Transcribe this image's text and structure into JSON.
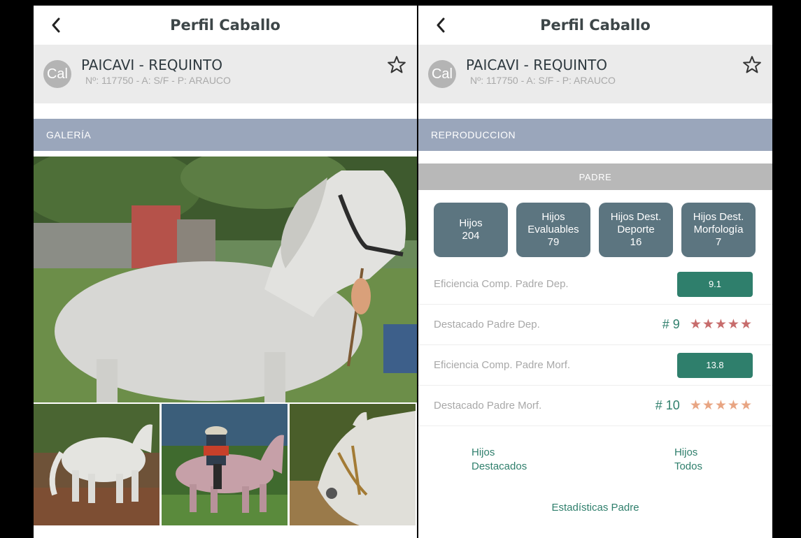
{
  "left": {
    "title": "Perfil Caballo",
    "horse": {
      "avatar_text": "Cal",
      "name": "PAICAVI - REQUINTO",
      "meta": "Nº: 117750 - A: S/F - P: ARAUCO"
    },
    "section": "GALERÍA"
  },
  "right": {
    "title": "Perfil Caballo",
    "horse": {
      "avatar_text": "Cal",
      "name": "PAICAVI - REQUINTO",
      "meta": "Nº: 117750 - A: S/F - P: ARAUCO"
    },
    "section": "REPRODUCCION",
    "subsection": "PADRE",
    "stats": [
      {
        "line1": "Hijos",
        "line2": "",
        "value": "204"
      },
      {
        "line1": "Hijos",
        "line2": "Evaluables",
        "value": "79"
      },
      {
        "line1": "Hijos Dest.",
        "line2": "Deporte",
        "value": "16"
      },
      {
        "line1": "Hijos Dest.",
        "line2": "Morfología",
        "value": "7"
      }
    ],
    "metrics": [
      {
        "label": "Eficiencia Comp. Padre Dep.",
        "value": "9.1"
      },
      {
        "label": "Destacado Padre Dep.",
        "rank": "# 9",
        "stars": "★★★★★",
        "rating": 5
      },
      {
        "label": "Eficiencia Comp. Padre Morf.",
        "value": "13.8"
      },
      {
        "label": "Destacado Padre Morf.",
        "rank": "# 10",
        "stars": "★★★★★",
        "rating": 5
      }
    ],
    "links": {
      "destacados_l1": "Hijos",
      "destacados_l2": "Destacados",
      "todos_l1": "Hijos",
      "todos_l2": "Todos",
      "estadisticas": "Estadísticas Padre"
    }
  },
  "colors": {
    "section_bar": "#9aa6bb",
    "stat_tile": "#5c7580",
    "accent_green": "#2f7f6c",
    "star_dark": "#c76c6c",
    "star_light": "#e8a583"
  },
  "icons": [
    "back-arrow-icon",
    "star-outline-icon",
    "star-filled-icon"
  ]
}
